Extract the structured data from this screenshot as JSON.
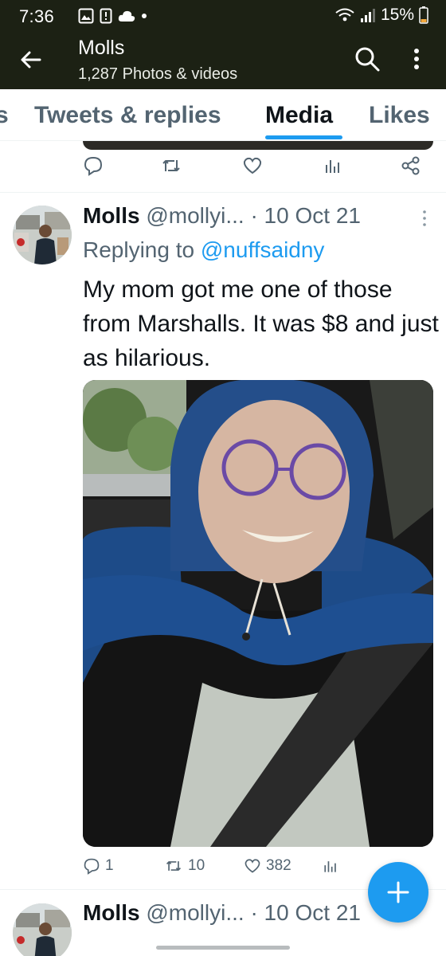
{
  "status_bar": {
    "time": "7:36",
    "battery": "15%"
  },
  "header": {
    "title": "Molls",
    "subtitle": "1,287 Photos & videos"
  },
  "tabs": [
    {
      "label": "s",
      "active": false
    },
    {
      "label": "Tweets & replies",
      "active": false
    },
    {
      "label": "Media",
      "active": true
    },
    {
      "label": "Likes",
      "active": false
    }
  ],
  "tweet": {
    "name": "Molls",
    "handle": "@mollyi...",
    "date": "· 10 Oct 21",
    "reply_prefix": "Replying to",
    "reply_to": "@nuffsaidny",
    "text": "My mom got me one of those from Marshalls. It was $8 and just as hilarious.",
    "replies": "1",
    "retweets": "10",
    "likes": "382"
  },
  "next_tweet": {
    "name": "Molls",
    "handle": "@mollyi...",
    "date": "· 10 Oct 21"
  },
  "colors": {
    "accent": "#1d9bf0",
    "header_bg": "#1c2114",
    "muted": "#536471"
  },
  "icons": [
    "back-arrow-icon",
    "search-icon",
    "more-vertical-icon",
    "reply-icon",
    "retweet-icon",
    "like-icon",
    "analytics-icon",
    "share-icon",
    "compose-plus-icon"
  ]
}
